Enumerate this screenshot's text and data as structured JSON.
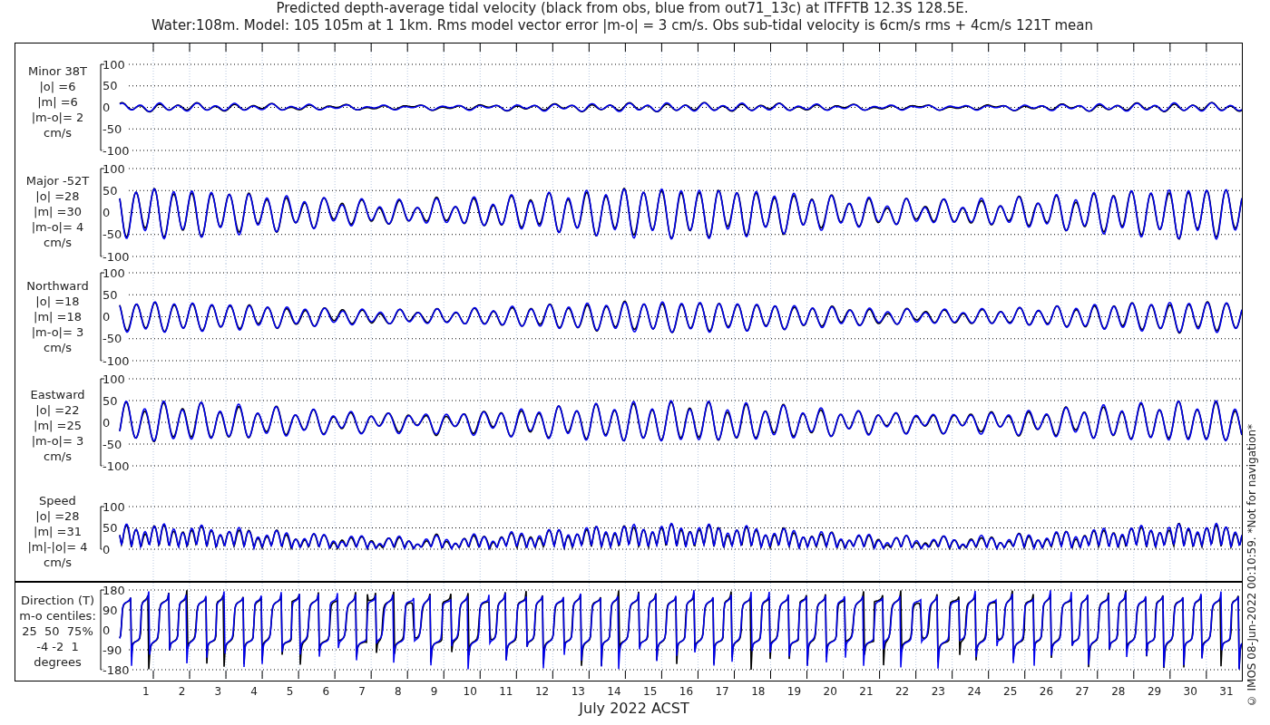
{
  "title_lines": [
    "Predicted depth-average tidal velocity (black from obs, blue from out71_13c) at ITFFTB 12.3S 128.5E.",
    "Water:108m. Model: 105 105m at 1 1km. Rms model vector error |m-o| = 3 cm/s. Obs sub-tidal velocity is 6cm/s rms + 4cm/s 121T mean"
  ],
  "panels": [
    {
      "kind": "minor",
      "label_lines": [
        "Minor 38T",
        "|o| =6",
        "|m| =6",
        "|m-o|= 2",
        "cm/s"
      ],
      "yticks": [
        "100",
        "50",
        "0",
        "-50",
        "-100"
      ]
    },
    {
      "kind": "major",
      "label_lines": [
        "Major -52T",
        "|o| =28",
        "|m| =30",
        "|m-o|= 4",
        "cm/s"
      ],
      "yticks": [
        "100",
        "50",
        "0",
        "-50",
        "-100"
      ]
    },
    {
      "kind": "northward",
      "label_lines": [
        "Northward",
        "|o| =18",
        "|m| =18",
        "|m-o|= 3",
        "cm/s"
      ],
      "yticks": [
        "100",
        "50",
        "0",
        "-50",
        "-100"
      ]
    },
    {
      "kind": "eastward",
      "label_lines": [
        "Eastward",
        "|o| =22",
        "|m| =25",
        "|m-o|= 3",
        "cm/s"
      ],
      "yticks": [
        "100",
        "50",
        "0",
        "-50",
        "-100"
      ]
    },
    {
      "kind": "speed",
      "label_lines": [
        "Speed",
        "|o| =28",
        "|m| =31",
        "|m|-|o|= 4",
        "cm/s"
      ],
      "yticks": [
        "100",
        "50",
        "0"
      ]
    },
    {
      "kind": "direction",
      "label_lines": [
        "Direction (T)",
        "m-o centiles:",
        "25  50  75%",
        "-4 -2  1",
        "degrees"
      ],
      "yticks": [
        "180",
        "90",
        "0",
        "-90",
        "-180"
      ]
    }
  ],
  "x_axis": {
    "days": [
      "1",
      "2",
      "3",
      "4",
      "5",
      "6",
      "7",
      "8",
      "9",
      "10",
      "11",
      "12",
      "13",
      "14",
      "15",
      "16",
      "17",
      "18",
      "19",
      "20",
      "21",
      "22",
      "23",
      "24",
      "25",
      "26",
      "27",
      "28",
      "29",
      "30",
      "31"
    ],
    "label": "July 2022 ACST"
  },
  "credit": "© IMOS 08-Jun-2022 00:10:59. *Not for navigation*"
}
